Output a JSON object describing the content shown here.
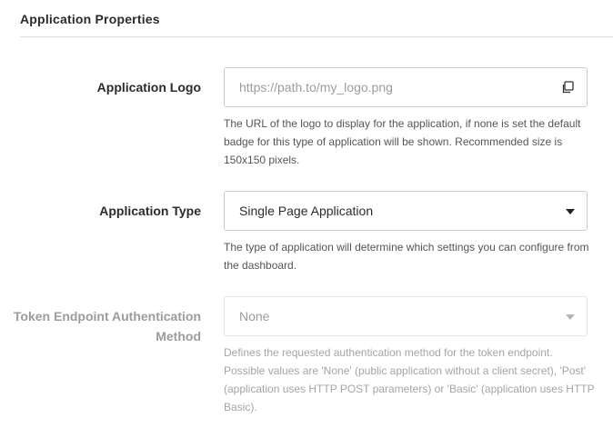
{
  "section": {
    "title": "Application Properties"
  },
  "fields": {
    "logo": {
      "label": "Application Logo",
      "placeholder": "https://path.to/my_logo.png",
      "help": "The URL of the logo to display for the application, if none is set the default badge for this type of application will be shown. Recommended size is 150x150 pixels.",
      "icon": "copy-icon"
    },
    "app_type": {
      "label": "Application Type",
      "value": "Single Page Application",
      "help": "The type of application will determine which settings you can configure from the dashboard.",
      "icon": "chevron-down-icon"
    },
    "token_auth": {
      "label": "Token Endpoint Authentication Method",
      "value": "None",
      "help": "Defines the requested authentication method for the token endpoint. Possible values are 'None' (public application without a client secret), 'Post' (application uses HTTP POST parameters) or 'Basic' (application uses HTTP Basic).",
      "icon": "chevron-down-icon",
      "disabled": true
    }
  },
  "colors": {
    "text": "#2b2b2b",
    "muted": "#9c9c9c",
    "border": "#cccccc",
    "divider": "#dedede"
  }
}
